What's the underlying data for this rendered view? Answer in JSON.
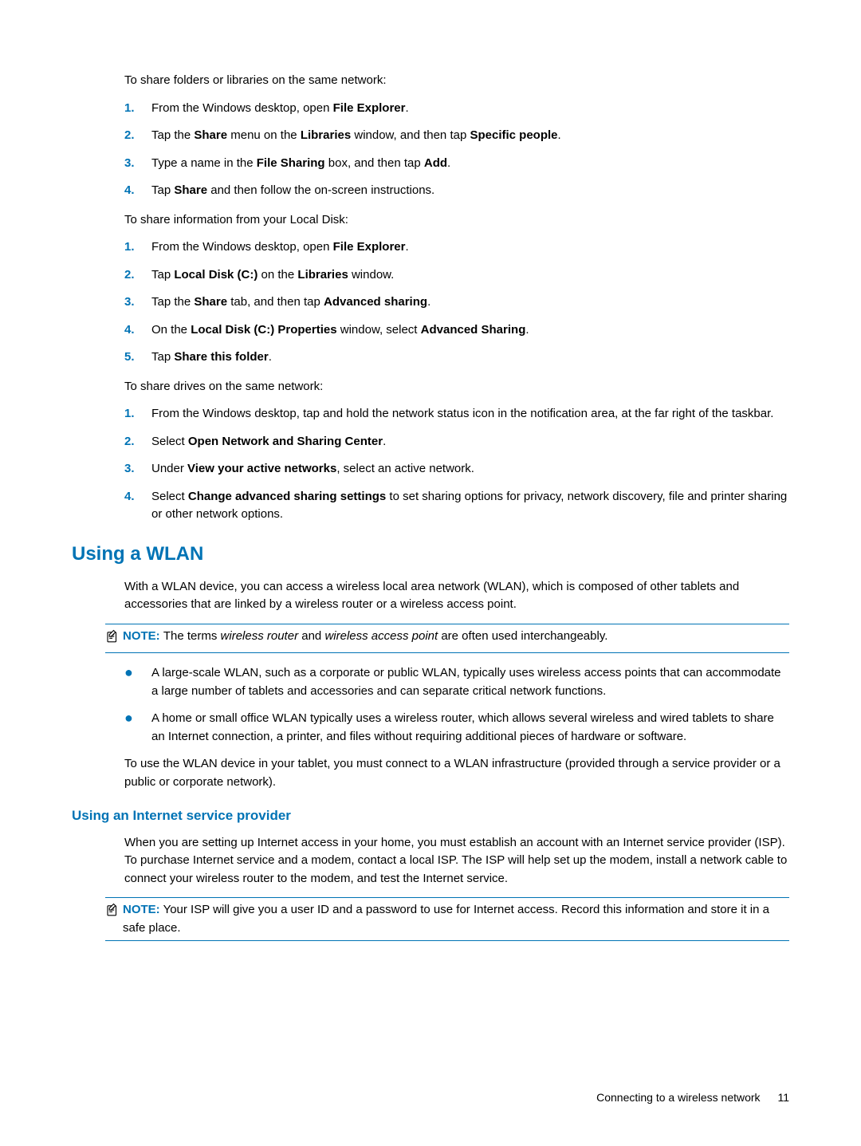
{
  "section1": {
    "intro": "To share folders or libraries on the same network:",
    "steps": [
      {
        "num": "1.",
        "parts": [
          "From the Windows desktop, open ",
          {
            "b": "File Explorer"
          },
          "."
        ]
      },
      {
        "num": "2.",
        "parts": [
          "Tap the ",
          {
            "b": "Share"
          },
          " menu on the ",
          {
            "b": "Libraries"
          },
          " window, and then tap ",
          {
            "b": "Specific people"
          },
          "."
        ]
      },
      {
        "num": "3.",
        "parts": [
          "Type a name in the ",
          {
            "b": "File Sharing"
          },
          " box, and then tap ",
          {
            "b": "Add"
          },
          "."
        ]
      },
      {
        "num": "4.",
        "parts": [
          "Tap ",
          {
            "b": "Share"
          },
          " and then follow the on-screen instructions."
        ]
      }
    ]
  },
  "section2": {
    "intro": "To share information from your Local Disk:",
    "steps": [
      {
        "num": "1.",
        "parts": [
          "From the Windows desktop, open ",
          {
            "b": "File Explorer"
          },
          "."
        ]
      },
      {
        "num": "2.",
        "parts": [
          "Tap ",
          {
            "b": "Local Disk (C:)"
          },
          " on the ",
          {
            "b": "Libraries"
          },
          " window."
        ]
      },
      {
        "num": "3.",
        "parts": [
          "Tap the ",
          {
            "b": "Share"
          },
          " tab, and then tap ",
          {
            "b": "Advanced sharing"
          },
          "."
        ]
      },
      {
        "num": "4.",
        "parts": [
          "On the ",
          {
            "b": "Local Disk (C:) Properties"
          },
          " window, select ",
          {
            "b": "Advanced Sharing"
          },
          "."
        ]
      },
      {
        "num": "5.",
        "parts": [
          "Tap ",
          {
            "b": "Share this folder"
          },
          "."
        ]
      }
    ]
  },
  "section3": {
    "intro": "To share drives on the same network:",
    "steps": [
      {
        "num": "1.",
        "parts": [
          "From the Windows desktop, tap and hold the network status icon in the notification area, at the far right of the taskbar."
        ]
      },
      {
        "num": "2.",
        "parts": [
          "Select ",
          {
            "b": "Open Network and Sharing Center"
          },
          "."
        ]
      },
      {
        "num": "3.",
        "parts": [
          "Under ",
          {
            "b": "View your active networks"
          },
          ", select an active network."
        ]
      },
      {
        "num": "4.",
        "parts": [
          "Select ",
          {
            "b": "Change advanced sharing settings"
          },
          " to set sharing options for privacy, network discovery, file and printer sharing or other network options."
        ]
      }
    ]
  },
  "wlan": {
    "heading": "Using a WLAN",
    "para": "With a WLAN device, you can access a wireless local area network (WLAN), which is composed of other tablets and accessories that are linked by a wireless router or a wireless access point.",
    "note_label": "NOTE:",
    "note_parts": [
      "The terms ",
      {
        "i": "wireless router"
      },
      " and ",
      {
        "i": "wireless access point"
      },
      " are often used interchangeably."
    ],
    "bullets": [
      "A large-scale WLAN, such as a corporate or public WLAN, typically uses wireless access points that can accommodate a large number of tablets and accessories and can separate critical network functions.",
      "A home or small office WLAN typically uses a wireless router, which allows several wireless and wired tablets to share an Internet connection, a printer, and files without requiring additional pieces of hardware or software."
    ],
    "closing": "To use the WLAN device in your tablet, you must connect to a WLAN infrastructure (provided through a service provider or a public or corporate network)."
  },
  "isp": {
    "heading": "Using an Internet service provider",
    "para": "When you are setting up Internet access in your home, you must establish an account with an Internet service provider (ISP). To purchase Internet service and a modem, contact a local ISP. The ISP will help set up the modem, install a network cable to connect your wireless router to the modem, and test the Internet service.",
    "note_label": "NOTE:",
    "note_text": "Your ISP will give you a user ID and a password to use for Internet access. Record this information and store it in a safe place."
  },
  "footer": {
    "text": "Connecting to a wireless network",
    "page": "11"
  }
}
